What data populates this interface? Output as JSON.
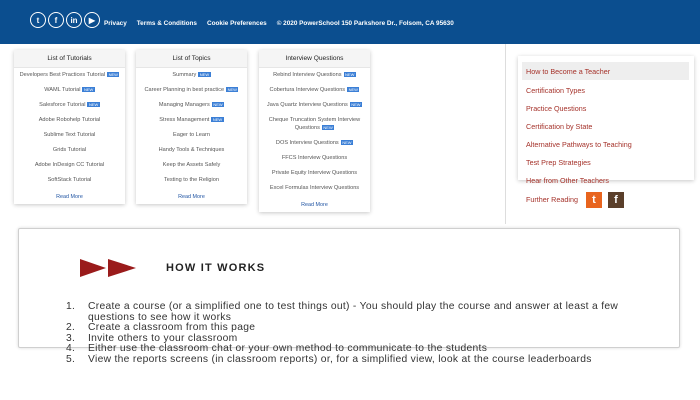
{
  "footer": {
    "social": [
      {
        "icon": "twitter-icon",
        "glyph": "t"
      },
      {
        "icon": "facebook-icon",
        "glyph": "f"
      },
      {
        "icon": "linkedin-icon",
        "glyph": "in"
      },
      {
        "icon": "youtube-icon",
        "glyph": "▶"
      }
    ],
    "links": [
      "Privacy",
      "Terms & Conditions",
      "Cookie Preferences"
    ],
    "copyright": "© 2020 PowerSchool 150 Parkshore Dr., Folsom, CA 95630",
    "bg_color": "#0b4e8f"
  },
  "cards": [
    {
      "title": "List of Tutorials",
      "items": [
        {
          "label": "Developers Best Practices Tutorial",
          "new": true
        },
        {
          "label": "WAML Tutorial",
          "new": true
        },
        {
          "label": "Salesforce Tutorial",
          "new": true
        },
        {
          "label": "Adobe Robohelp Tutorial",
          "new": false
        },
        {
          "label": "Sublime Text Tutorial",
          "new": false
        },
        {
          "label": "Grids Tutorial",
          "new": false
        },
        {
          "label": "Adobe InDesign CC Tutorial",
          "new": false
        },
        {
          "label": "SoftStack Tutorial",
          "new": false
        }
      ],
      "more": "Read More"
    },
    {
      "title": "List of Topics",
      "items": [
        {
          "label": "Summary",
          "new": true
        },
        {
          "label": "Career Planning in best practice",
          "new": true
        },
        {
          "label": "Managing Managers",
          "new": true
        },
        {
          "label": "Stress Management",
          "new": true
        },
        {
          "label": "Eager to Learn",
          "new": false
        },
        {
          "label": "Handy Tools & Techniques",
          "new": false
        },
        {
          "label": "Keep the Assets Safely",
          "new": false
        },
        {
          "label": "Testing to the Religion",
          "new": false
        }
      ],
      "more": "Read More"
    },
    {
      "title": "Interview Questions",
      "items": [
        {
          "label": "Rebind Interview Questions",
          "new": true
        },
        {
          "label": "Cobertura Interview Questions",
          "new": true
        },
        {
          "label": "Java Quartz Interview Questions",
          "new": true
        },
        {
          "label": "Cheque Truncation System Interview Questions",
          "new": true
        },
        {
          "label": "DOS Interview Questions",
          "new": true
        },
        {
          "label": "FFCS Interview Questions",
          "new": false
        },
        {
          "label": "Private Equity Interview Questions",
          "new": false
        },
        {
          "label": "Excel Formulas Interview Questions",
          "new": false
        }
      ],
      "more": "Read More",
      "new_badge": "NEW"
    }
  ],
  "right_links": [
    "How to Become a Teacher",
    "Certification Types",
    "Practice Questions",
    "Certification by State",
    "Alternative Pathways to Teaching",
    "Test Prep Strategies",
    "Hear from Other Teachers",
    "Further Reading"
  ],
  "share": [
    {
      "icon": "twitter-icon",
      "glyph": "t",
      "color": "#e8641e"
    },
    {
      "icon": "facebook-icon",
      "glyph": "f",
      "color": "#5a3f2a"
    }
  ],
  "how_it_works": {
    "title": "HOW IT WORKS",
    "arrow_color": "#9a1b1b",
    "steps": [
      {
        "num": "1.",
        "text": "Create a course (or a simplified one to test things out) - You should play the course and answer at least a few questions to see how it works"
      },
      {
        "num": "2.",
        "text": "Create a classroom from this page"
      },
      {
        "num": "3.",
        "text": "Invite others to your classroom"
      },
      {
        "num": "4.",
        "text": "Either use the classroom chat or your own method to communicate to the students"
      },
      {
        "num": "5.",
        "text": "View the reports screens (in classroom reports) or, for a simplified view, look at the course leaderboards"
      }
    ]
  }
}
